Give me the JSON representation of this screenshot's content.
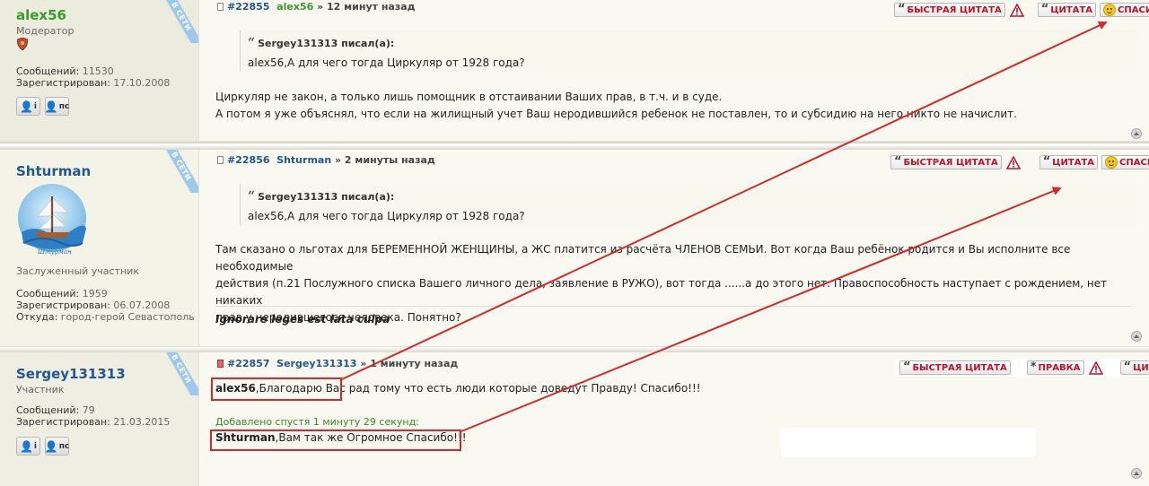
{
  "posts": [
    {
      "user": "alex56",
      "user_color": "#3a9a2a",
      "role": "Модератор",
      "online_badge": "В СЕТИ",
      "stats": [
        {
          "label": "Сообщений:",
          "value": "11530"
        },
        {
          "label": "Зарегистрирован:",
          "value": "17.10.2008"
        }
      ],
      "post_number": "#22855",
      "post_time": "» 12 минут назад",
      "buttons": {
        "quick_quote": "БЫСТРАЯ ЦИТАТА",
        "quote": "ЦИТАТА",
        "thanks": "СПАСИБО"
      },
      "quote": {
        "author": "Sergey131313 писал(а):",
        "text": "alex56,А для чего тогда Циркуляр от 1928 года?"
      },
      "body": [
        "Циркуляр не закон, а только лишь помощник в отстаивании Ваших прав, в т.ч. и в суде.",
        "А потом я уже объяснял, что если на жилищный учет Ваш неродившийся ребенок не поставлен, то и субсидию на него никто не начислит."
      ]
    },
    {
      "user": "Shturman",
      "user_color": "#23588d",
      "role": "Заслуженный участник",
      "online_badge": "В СЕТИ",
      "avatar_caption": "Штурман",
      "stats": [
        {
          "label": "Сообщений:",
          "value": "1959"
        },
        {
          "label": "Зарегистрирован:",
          "value": "06.07.2008"
        },
        {
          "label": "Откуда:",
          "value": "город-герой Севастополь"
        }
      ],
      "post_number": "#22856",
      "post_time": "» 2 минуты назад",
      "buttons": {
        "quick_quote": "БЫСТРАЯ ЦИТАТА",
        "quote": "ЦИТАТА",
        "thanks": "СПАСИБО"
      },
      "quote": {
        "author": "Sergey131313 писал(а):",
        "text": "alex56,А для чего тогда Циркуляр от 1928 года?"
      },
      "body": [
        "Там сказано о льготах для БЕРЕМЕННОЙ ЖЕНЩИНЫ, а ЖС платится из расчёта ЧЛЕНОВ СЕМЬИ. Вот когда Ваш ребёнок родится и Вы исполните все необходимые",
        "действия (п.21 Послужного списка Вашего личного дела, заявление в РУЖО), вот тогда ......а до этого нет. Правоспособность наступает с рождением, нет никаких",
        "прав у неродившегося человека. Понятно?"
      ],
      "signature": "Ignorare leges est lata culpa"
    },
    {
      "user": "Sergey131313",
      "user_color": "#23588d",
      "role": "Участник",
      "online_badge": "В СЕТИ",
      "stats": [
        {
          "label": "Сообщений:",
          "value": "79"
        },
        {
          "label": "Зарегистрирован:",
          "value": "21.03.2015"
        }
      ],
      "post_number": "#22857",
      "post_time": "» 1 минуту назад",
      "buttons": {
        "quick_quote": "БЫСТРАЯ ЦИТАТА",
        "edit": "ПРАВКА",
        "quote": "ЦИТАТА"
      },
      "line1_name": "alex56",
      "line1_rest": ",Благодарю Вас",
      "line1_tail": " рад тому что есть люди которые доведут Правду! Спасибо!!!",
      "added_note": "Добавлено спустя 1 минуту 29 секунд:",
      "line2_name": "Shturman",
      "line2_rest": ",Вам так же Огромное Спасибо!!!"
    }
  ],
  "profile_buttons": {
    "info": "i",
    "pm": "пс"
  },
  "colors": {
    "highlight": "#d42a2a",
    "link": "#23588d",
    "moderator": "#3a9a2a"
  }
}
